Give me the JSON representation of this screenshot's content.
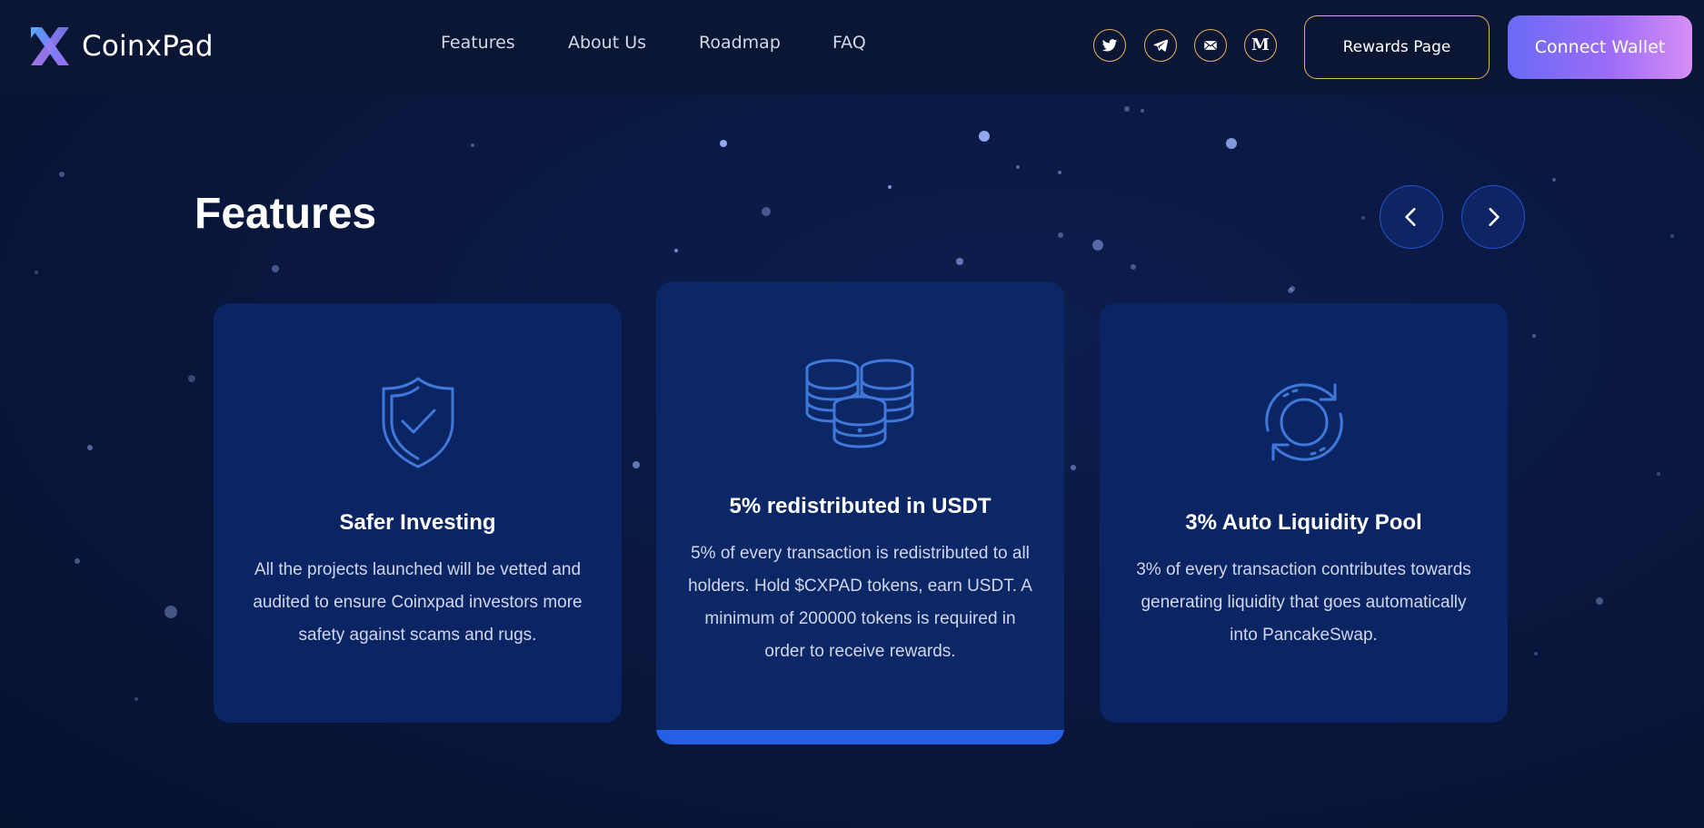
{
  "header": {
    "brand": "CoinxPad",
    "nav": [
      "Features",
      "About Us",
      "Roadmap",
      "FAQ"
    ],
    "social": [
      "twitter-icon",
      "telegram-icon",
      "mail-icon",
      "medium-icon"
    ],
    "medium_glyph": "M",
    "rewards_label": "Rewards Page",
    "connect_label": "Connect Wallet"
  },
  "features": {
    "title": "Features",
    "cards": [
      {
        "icon": "shield-check-icon",
        "title": "Safer Investing",
        "text": "All the projects launched will be vetted and audited to ensure Coinxpad investors more safety against scams and rugs."
      },
      {
        "icon": "coins-stack-icon",
        "title": "5% redistributed in USDT",
        "text": "5% of every transaction is redistributed to all holders. Hold $CXPAD tokens, earn USDT. A minimum of 200000 tokens is required in order to receive rewards."
      },
      {
        "icon": "refresh-cycle-icon",
        "title": "3% Auto Liquidity Pool",
        "text": "3% of every transaction contributes towards generating liquidity that goes automatically into PancakeSwap."
      }
    ]
  },
  "colors": {
    "background": "#0a1840",
    "header": "#0b1635",
    "card": "#0b2564",
    "accent_gold": "#e3b35c",
    "accent_blue": "#2460e6",
    "connect_gradient_start": "#6a6bf6",
    "connect_gradient_end": "#d68ef6"
  }
}
